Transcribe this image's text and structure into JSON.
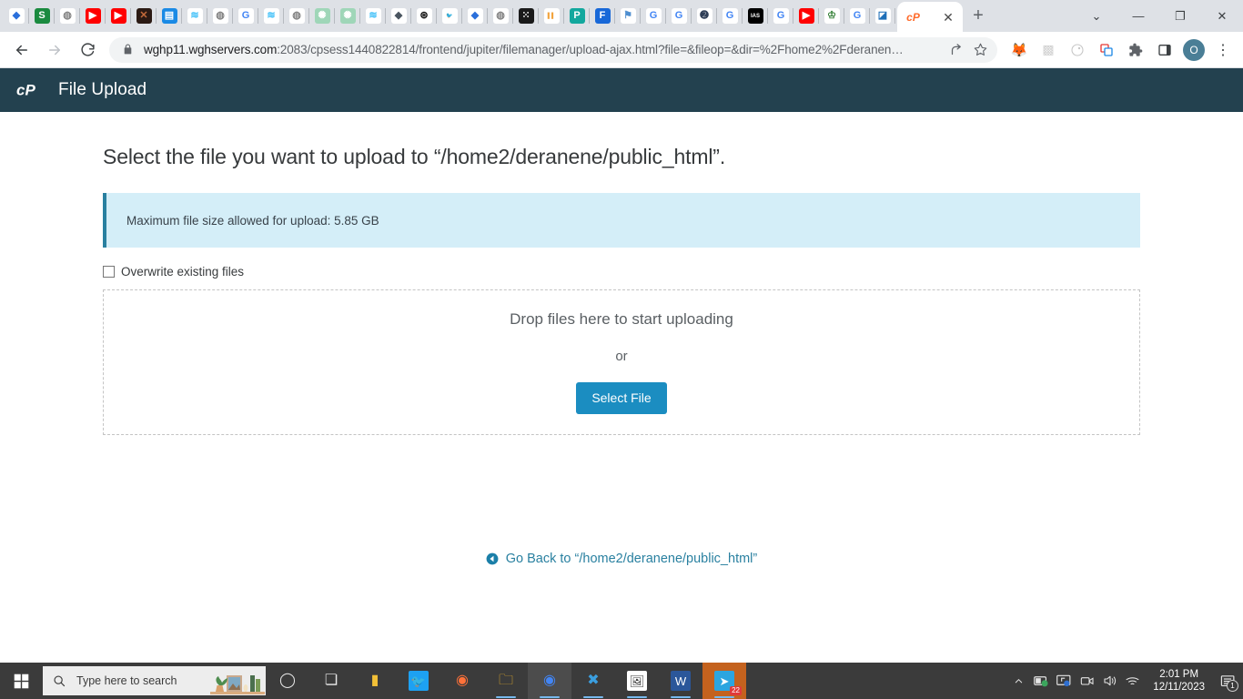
{
  "browser": {
    "tab_icons": [
      {
        "name": "favicon-diamond-blue",
        "glyph": "◆",
        "bg": "#ffffff",
        "fg": "#2a6fdb"
      },
      {
        "name": "favicon-s-green",
        "glyph": "S",
        "bg": "#1a8a3f",
        "fg": "#ffffff"
      },
      {
        "name": "favicon-globe-gray",
        "glyph": "◍",
        "bg": "#ffffff",
        "fg": "#808080"
      },
      {
        "name": "favicon-youtube",
        "glyph": "▶",
        "bg": "#ff0000",
        "fg": "#ffffff"
      },
      {
        "name": "favicon-youtube",
        "glyph": "▶",
        "bg": "#ff0000",
        "fg": "#ffffff"
      },
      {
        "name": "favicon-x-twitter",
        "glyph": "✕",
        "bg": "#2b1a14",
        "fg": "#c46a3a"
      },
      {
        "name": "favicon-document-blue",
        "glyph": "▤",
        "bg": "#1a8ae5",
        "fg": "#ffffff"
      },
      {
        "name": "favicon-waves-teal",
        "glyph": "≋",
        "bg": "#ffffff",
        "fg": "#38bdf8"
      },
      {
        "name": "favicon-globe-gray",
        "glyph": "◍",
        "bg": "#ffffff",
        "fg": "#808080"
      },
      {
        "name": "favicon-google",
        "glyph": "G",
        "bg": "#ffffff",
        "fg": "#4285f4"
      },
      {
        "name": "favicon-waves-teal",
        "glyph": "≋",
        "bg": "#ffffff",
        "fg": "#38bdf8"
      },
      {
        "name": "favicon-globe-gray",
        "glyph": "◍",
        "bg": "#ffffff",
        "fg": "#808080"
      },
      {
        "name": "favicon-openai",
        "glyph": "✺",
        "bg": "#9fd6b8",
        "fg": "#ffffff"
      },
      {
        "name": "favicon-openai",
        "glyph": "✺",
        "bg": "#9fd6b8",
        "fg": "#ffffff"
      },
      {
        "name": "favicon-waves-teal",
        "glyph": "≋",
        "bg": "#ffffff",
        "fg": "#38bdf8"
      },
      {
        "name": "favicon-layers-dark",
        "glyph": "◆",
        "bg": "#ffffff",
        "fg": "#4a5560"
      },
      {
        "name": "favicon-target-dark",
        "glyph": "⊛",
        "bg": "#ffffff",
        "fg": "#111111"
      },
      {
        "name": "favicon-twitter",
        "glyph": "🐦",
        "bg": "#ffffff",
        "fg": "#1da1f2"
      },
      {
        "name": "favicon-diamond-blue",
        "glyph": "◆",
        "bg": "#ffffff",
        "fg": "#2a6fdb"
      },
      {
        "name": "favicon-globe-gray",
        "glyph": "◍",
        "bg": "#ffffff",
        "fg": "#808080"
      },
      {
        "name": "favicon-network-dark",
        "glyph": "⁙",
        "bg": "#1a1a1a",
        "fg": "#ffffff"
      },
      {
        "name": "favicon-colorful-blocks",
        "glyph": "▌▌",
        "bg": "#ffffff",
        "fg": "#f2a33c"
      },
      {
        "name": "favicon-p-teal",
        "glyph": "P",
        "bg": "#13a89e",
        "fg": "#ffffff"
      },
      {
        "name": "favicon-f-blue",
        "glyph": "F",
        "bg": "#1868d8",
        "fg": "#ffffff"
      },
      {
        "name": "favicon-flag-blue",
        "glyph": "⚑",
        "bg": "#ffffff",
        "fg": "#4f8fd0"
      },
      {
        "name": "favicon-google",
        "glyph": "G",
        "bg": "#ffffff",
        "fg": "#4285f4"
      },
      {
        "name": "favicon-google",
        "glyph": "G",
        "bg": "#ffffff",
        "fg": "#4285f4"
      },
      {
        "name": "favicon-swirl-dark",
        "glyph": "➋",
        "bg": "#ffffff",
        "fg": "#2e3d56"
      },
      {
        "name": "favicon-google",
        "glyph": "G",
        "bg": "#ffffff",
        "fg": "#4285f4"
      },
      {
        "name": "favicon-ias-black",
        "glyph": "IAS",
        "bg": "#000000",
        "fg": "#ffffff"
      },
      {
        "name": "favicon-google",
        "glyph": "G",
        "bg": "#ffffff",
        "fg": "#4285f4"
      },
      {
        "name": "favicon-youtube",
        "glyph": "▶",
        "bg": "#ff0000",
        "fg": "#ffffff"
      },
      {
        "name": "favicon-crest-green",
        "glyph": "♔",
        "bg": "#ffffff",
        "fg": "#2f7d32"
      },
      {
        "name": "favicon-google",
        "glyph": "G",
        "bg": "#ffffff",
        "fg": "#4285f4"
      },
      {
        "name": "favicon-bookmark-blue",
        "glyph": "◪",
        "bg": "#ffffff",
        "fg": "#1f6fb8"
      }
    ],
    "active_tab": {
      "favicon_name": "cpanel-favicon",
      "favicon_glyph": "cP",
      "favicon_color": "#ff6c2c",
      "close_label": "✕"
    },
    "new_tab_label": "+",
    "window_controls": {
      "tab_search": "⌄",
      "minimize": "—",
      "maximize": "❐",
      "close": "✕"
    },
    "nav": {
      "back": "←",
      "forward": "→",
      "reload": "⟳"
    },
    "url": {
      "domain": "wghp11.wghservers.com",
      "path": ":2083/cpsess1440822814/frontend/jupiter/filemanager/upload-ajax.html?file=&fileop=&dir=%2Fhome2%2Fderanen…",
      "lock_icon": "lock-icon"
    },
    "toolbar_icons": [
      {
        "name": "share-icon",
        "glyph": "↗"
      },
      {
        "name": "bookmark-star-icon",
        "glyph": "☆"
      },
      {
        "name": "metamask-extension-icon",
        "glyph": "🦊"
      },
      {
        "name": "grammarly-extension-icon",
        "glyph": "▩"
      },
      {
        "name": "honey-extension-icon",
        "glyph": "◎"
      },
      {
        "name": "tab-groups-icon",
        "glyph": "❐"
      },
      {
        "name": "extensions-puzzle-icon",
        "glyph": "🧩"
      },
      {
        "name": "side-panel-icon",
        "glyph": "◨"
      }
    ],
    "profile_initial": "O",
    "menu_glyph": "⋮"
  },
  "cpanel": {
    "brand_logo": "cpanel-logo",
    "brand_logo_text": "cP",
    "app_title": "File Upload",
    "heading": "Select the file you want to upload to “/home2/deranene/public_html”.",
    "alert": {
      "icon": "info-alert",
      "text": "Maximum file size allowed for upload: 5.85 GB",
      "bg_color": "#d4eef8",
      "accent_color": "#2980a0"
    },
    "overwrite": {
      "label": "Overwrite existing files",
      "checked": false
    },
    "dropzone": {
      "primary_text": "Drop files here to start uploading",
      "or_text": "or",
      "button_label": "Select File",
      "button_color": "#1b8dc1"
    },
    "go_back": {
      "icon": "back-circle-icon",
      "label": "Go Back to “/home2/deranene/public_html”",
      "link_color": "#2980a0"
    }
  },
  "taskbar": {
    "start_button": "start-button",
    "search_placeholder": "Type here to search",
    "search_icon": "search-icon",
    "pinned": [
      {
        "name": "cortana-icon",
        "glyph": "◯",
        "bg": "",
        "fg": "#e8e8e8",
        "running": false,
        "active": false
      },
      {
        "name": "task-view-icon",
        "glyph": "❏",
        "bg": "",
        "fg": "#e8e8e8",
        "running": false,
        "active": false
      },
      {
        "name": "power-bi-icon",
        "glyph": "▮",
        "bg": "",
        "fg": "#f2c037",
        "running": false,
        "active": false
      },
      {
        "name": "twitter-icon",
        "glyph": "🐦",
        "bg": "#1da1f2",
        "fg": "#ffffff",
        "running": false,
        "active": false
      },
      {
        "name": "firefox-icon",
        "glyph": "◉",
        "bg": "",
        "fg": "#ff7139",
        "running": false,
        "active": false
      },
      {
        "name": "file-explorer-icon",
        "glyph": "🗀",
        "bg": "",
        "fg": "#f0b429",
        "running": true,
        "active": false
      },
      {
        "name": "google-chrome-icon",
        "glyph": "◉",
        "bg": "",
        "fg": "#4285f4",
        "running": true,
        "active": true
      },
      {
        "name": "vs-code-icon",
        "glyph": "✖",
        "bg": "",
        "fg": "#3b9fe0",
        "running": true,
        "active": false
      },
      {
        "name": "photos-icon",
        "glyph": "🖼",
        "bg": "#ffffff",
        "fg": "#333333",
        "running": true,
        "active": false
      },
      {
        "name": "word-icon",
        "glyph": "W",
        "bg": "#2b579a",
        "fg": "#ffffff",
        "running": true,
        "active": false
      },
      {
        "name": "telegram-icon",
        "glyph": "➤",
        "bg": "#2ca5e0",
        "fg": "#ffffff",
        "running": true,
        "active": false,
        "badge": "22"
      }
    ],
    "tray": [
      {
        "name": "show-hidden-icons-chevron",
        "glyph": "︿"
      },
      {
        "name": "battery-saver-icon",
        "glyph": "🔋"
      },
      {
        "name": "screen-cast-icon",
        "glyph": "🖵"
      },
      {
        "name": "camera-icon",
        "glyph": "🎥"
      },
      {
        "name": "volume-icon",
        "glyph": "🔊"
      },
      {
        "name": "wifi-icon",
        "glyph": "📶"
      }
    ],
    "clock": {
      "time": "2:01 PM",
      "date": "12/11/2023"
    },
    "notifications": {
      "icon": "action-center-icon",
      "count": "1"
    }
  }
}
